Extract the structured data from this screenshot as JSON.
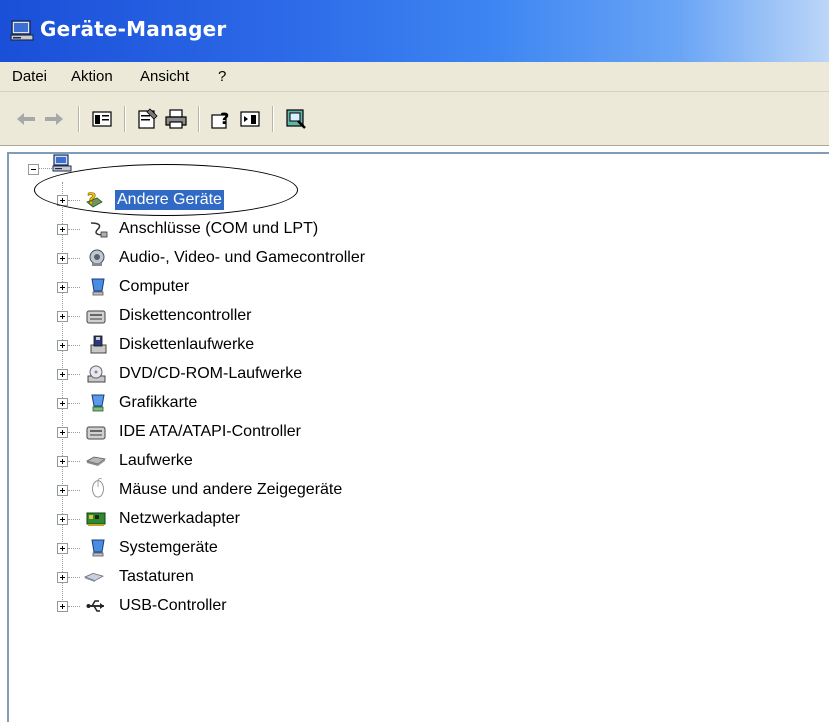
{
  "window": {
    "title": "Geräte-Manager",
    "titlebar_color": "#2d6ae8"
  },
  "menu": {
    "items": [
      "Datei",
      "Aktion",
      "Ansicht",
      "?"
    ]
  },
  "toolbar": {
    "buttons": [
      {
        "icon": "back-arrow-icon"
      },
      {
        "icon": "forward-arrow-icon"
      },
      {
        "icon": "show-hide-console-tree-icon"
      },
      {
        "icon": "properties-icon"
      },
      {
        "icon": "print-icon"
      },
      {
        "icon": "help-icon"
      },
      {
        "icon": "show-hide-action-pane-icon"
      },
      {
        "icon": "scan-hardware-icon"
      }
    ]
  },
  "tree": {
    "root_icon": "computer-icon",
    "selection_color": "#316ac5",
    "items": [
      {
        "label": "Andere Geräte",
        "icon": "unknown-device-icon",
        "selected": true
      },
      {
        "label": "Anschlüsse (COM und LPT)",
        "icon": "port-icon",
        "selected": false
      },
      {
        "label": "Audio-, Video- und Gamecontroller",
        "icon": "speaker-icon",
        "selected": false
      },
      {
        "label": "Computer",
        "icon": "computer-device-icon",
        "selected": false
      },
      {
        "label": "Diskettencontroller",
        "icon": "disk-controller-icon",
        "selected": false
      },
      {
        "label": "Diskettenlaufwerke",
        "icon": "floppy-drive-icon",
        "selected": false
      },
      {
        "label": "DVD/CD-ROM-Laufwerke",
        "icon": "cd-rom-icon",
        "selected": false
      },
      {
        "label": "Grafikkarte",
        "icon": "display-adapter-icon",
        "selected": false
      },
      {
        "label": "IDE ATA/ATAPI-Controller",
        "icon": "ide-controller-icon",
        "selected": false
      },
      {
        "label": "Laufwerke",
        "icon": "hard-drive-icon",
        "selected": false
      },
      {
        "label": "Mäuse und andere Zeigegeräte",
        "icon": "mouse-icon",
        "selected": false
      },
      {
        "label": "Netzwerkadapter",
        "icon": "network-adapter-icon",
        "selected": false
      },
      {
        "label": "Systemgeräte",
        "icon": "system-device-icon",
        "selected": false
      },
      {
        "label": "Tastaturen",
        "icon": "keyboard-icon",
        "selected": false
      },
      {
        "label": "USB-Controller",
        "icon": "usb-icon",
        "selected": false
      }
    ]
  }
}
